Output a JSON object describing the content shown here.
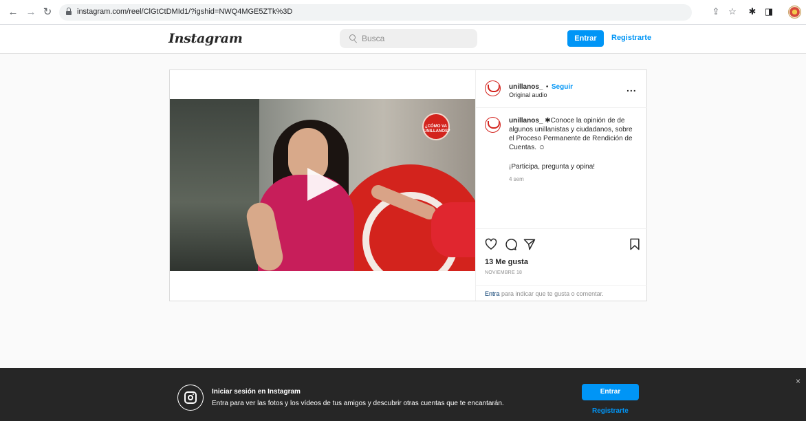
{
  "browser": {
    "url": "instagram.com/reel/ClGtCtDMId1/?igshid=NWQ4MGE5ZTk%3D",
    "icons": [
      "back-icon",
      "forward-icon",
      "reload-icon",
      "lock-icon",
      "share-icon",
      "star-icon",
      "extensions-icon",
      "sidebar-icon",
      "profile-avatar"
    ]
  },
  "header": {
    "logo": "Instagram",
    "search_placeholder": "Busca",
    "login_label": "Entrar",
    "signup_label": "Registrarte"
  },
  "post": {
    "username": "unillanos_",
    "separator": "•",
    "follow_label": "Seguir",
    "audio": "Original audio",
    "more_label": "...",
    "video_badge": "¿CÓMO VA UNILLANOS?",
    "caption_username": "unillanos_",
    "caption": "✱Conoce la opinión de de algunos unillanistas y ciudadanos, sobre el Proceso Permanente de Rendición de Cuentas. ☺",
    "caption_2": "¡Participa, pregunta y opina!",
    "time": "4 sem",
    "likes": "13 Me gusta",
    "date": "NOVIEMBRE 18",
    "login_link": "Entra",
    "login_text": " para indicar que te gusta o comentar."
  },
  "banner": {
    "title": "Iniciar sesión en Instagram",
    "subtitle": "Entra para ver las fotos y los vídeos de tus amigos y descubrir otras cuentas que te encantarán.",
    "login_label": "Entrar",
    "signup_label": "Registrarte",
    "close_label": "×"
  },
  "colors": {
    "accent": "#0095f6",
    "brand_red": "#d3231d",
    "banner_bg": "#262626"
  }
}
